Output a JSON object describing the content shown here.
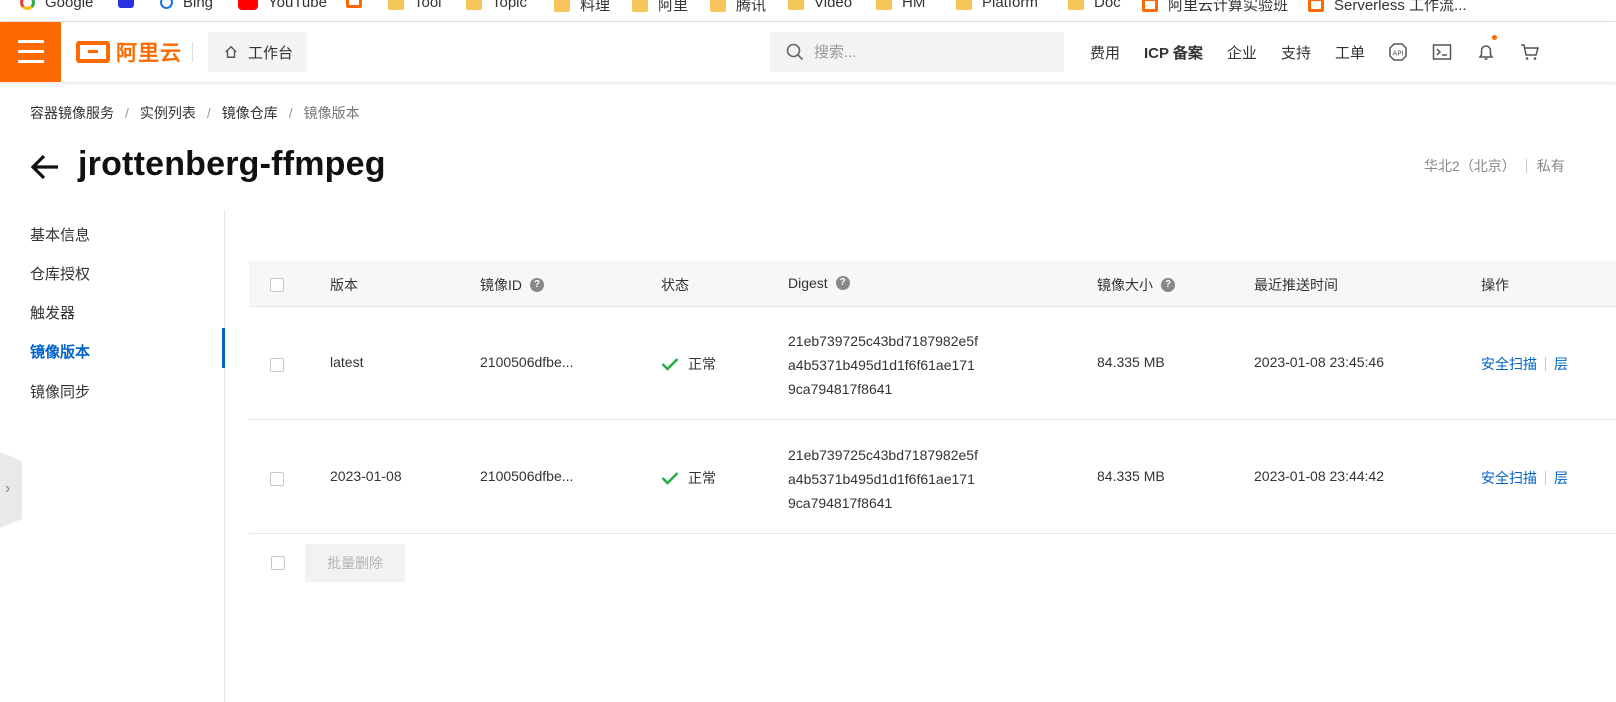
{
  "bookmarks": [
    "Google",
    "Bing",
    "YouTube",
    "Tool",
    "Topic",
    "料理",
    "阿里",
    "腾讯",
    "Video",
    "HM",
    "Platform",
    "Doc",
    "阿里云计算实验班",
    "Serverless 工作流..."
  ],
  "topbar": {
    "logo_text": "阿里云",
    "workbench": "工作台",
    "search_placeholder": "搜索...",
    "links": [
      "费用",
      "ICP 备案",
      "企业",
      "支持",
      "工单"
    ]
  },
  "breadcrumb": [
    "容器镜像服务",
    "实例列表",
    "镜像仓库",
    "镜像版本"
  ],
  "page": {
    "title": "jrottenberg-ffmpeg",
    "region": "华北2（北京）",
    "repo_type": "私有"
  },
  "sidenav": {
    "items": [
      "基本信息",
      "仓库授权",
      "触发器",
      "镜像版本",
      "镜像同步"
    ],
    "active": "镜像版本"
  },
  "table": {
    "headers": [
      "版本",
      "镜像ID",
      "状态",
      "Digest",
      "镜像大小",
      "最近推送时间",
      "操作"
    ],
    "rows": [
      {
        "version": "latest",
        "image_id": "2100506dfbe...",
        "status": "正常",
        "digest": [
          "21eb739725c43bd7187982e5f",
          "a4b5371b495d1d1f6f61ae171",
          "9ca794817f8641"
        ],
        "size": "84.335 MB",
        "pushed": "2023-01-08 23:45:46",
        "op_scan": "安全扫描",
        "op_more": "层"
      },
      {
        "version": "2023-01-08",
        "image_id": "2100506dfbe...",
        "status": "正常",
        "digest": [
          "21eb739725c43bd7187982e5f",
          "a4b5371b495d1d1f6f61ae171",
          "9ca794817f8641"
        ],
        "size": "84.335 MB",
        "pushed": "2023-01-08 23:44:42",
        "op_scan": "安全扫描",
        "op_more": "层"
      }
    ],
    "batch_delete": "批量删除"
  },
  "colors": {
    "brand": "#ff6a00",
    "link": "#0064c8",
    "ok": "#1fae3f"
  }
}
